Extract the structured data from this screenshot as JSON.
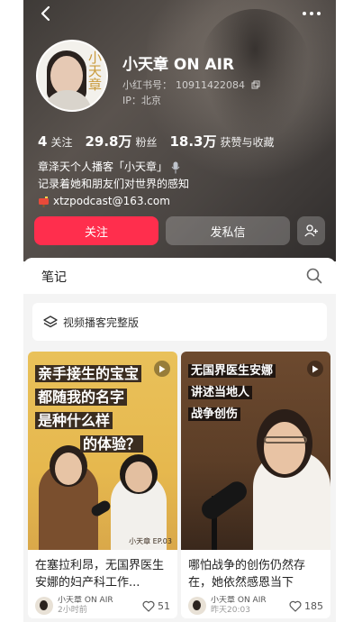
{
  "profile": {
    "name": "小天章 ON AIR",
    "red_id_label": "小红书号：",
    "red_id": "10911422084",
    "ip_label": "IP：",
    "ip": "北京",
    "avatar_mark": "小天章"
  },
  "stats": [
    {
      "value": "4",
      "label": "关注"
    },
    {
      "value": "29.8万",
      "label": "粉丝"
    },
    {
      "value": "18.3万",
      "label": "获赞与收藏"
    }
  ],
  "bio": {
    "line1": "章泽天个人播客「小天章」",
    "line2": "记录着她和朋友们对世界的感知",
    "email": "xtzpodcast@163.com"
  },
  "actions": {
    "follow_label": "关注",
    "message_label": "发私信"
  },
  "tabs": {
    "notes_label": "笔记"
  },
  "collection": {
    "label": "视频播客完整版"
  },
  "notes": [
    {
      "thumb_lines": [
        "亲手接生的宝宝",
        "都随我的名字",
        "是种什么样",
        "的体验？"
      ],
      "thumb_tag": "小天章 EP.03",
      "title": "在塞拉利昂，无国界医生安娜的妇产科工作...",
      "author": "小天章 ON AIR",
      "time": "2小时前",
      "likes": "51"
    },
    {
      "thumb_lines": [
        "无国界医生安娜",
        "讲述当地人",
        "战争创伤"
      ],
      "title": "哪怕战争的创伤仍然存在，她依然感恩当下",
      "author": "小天章 ON AIR",
      "time": "昨天20:03",
      "likes": "185"
    }
  ],
  "colors": {
    "accent": "#ff2e4d",
    "header_bg": "#4a4542",
    "sheet_bg": "#f4f4f4"
  },
  "icons": [
    "back-arrow-icon",
    "more-dots-icon",
    "copy-icon",
    "microphone-icon",
    "mailbox-icon",
    "add-friend-icon",
    "search-icon",
    "layers-icon",
    "play-icon",
    "heart-icon"
  ]
}
